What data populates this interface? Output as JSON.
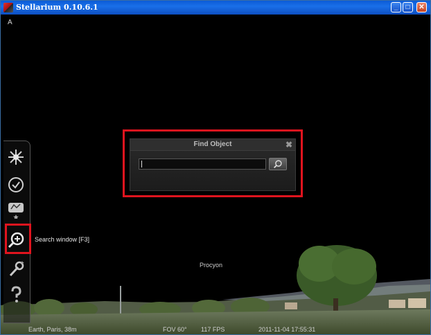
{
  "window": {
    "title": "Stellarium 0.10.6.1",
    "buttons": {
      "minimize": "_",
      "maximize": "□",
      "close": "✕"
    }
  },
  "overlay": {
    "cardinal_label": "A",
    "star_label": "Procyon"
  },
  "toolbar": {
    "items": [
      {
        "icon": "star-burst-icon"
      },
      {
        "icon": "clock-icon"
      },
      {
        "icon": "sky-culture-icon"
      },
      {
        "icon": "search-magnifier-icon"
      },
      {
        "icon": "wrench-icon"
      },
      {
        "icon": "help-icon"
      }
    ],
    "tooltip": "Search window  [F3]"
  },
  "find_dialog": {
    "title": "Find Object",
    "close_label": "✖",
    "input_value": ""
  },
  "status": {
    "location": "Earth, Paris, 38m",
    "fov": "FOV 60°",
    "fps": "117 FPS",
    "datetime": "2011-11-04   17:55:31"
  },
  "colors": {
    "highlight": "#e0141e",
    "titlebar": "#0b5bd6",
    "sky": "#000000"
  }
}
